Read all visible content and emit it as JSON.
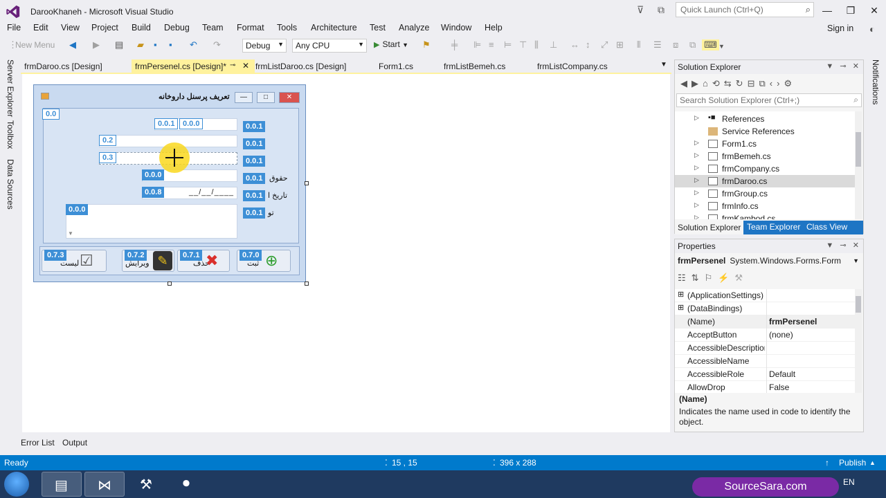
{
  "window": {
    "title": "DarooKhaneh - Microsoft Visual Studio",
    "quick_launch_placeholder": "Quick Launch (Ctrl+Q)"
  },
  "menu": [
    "File",
    "Edit",
    "View",
    "Project",
    "Build",
    "Debug",
    "Team",
    "Format",
    "Tools",
    "Architecture",
    "Test",
    "Analyze",
    "Window",
    "Help"
  ],
  "sign_in": "Sign in",
  "toolbar": {
    "new_menu": "New Menu",
    "config": "Debug",
    "platform": "Any CPU",
    "start": "Start"
  },
  "left_rail": [
    "Server Explorer",
    "Toolbox",
    "Data Sources"
  ],
  "right_rail": "Notifications",
  "doc_tabs": [
    {
      "label": "frmDaroo.cs [Design]"
    },
    {
      "label": "frmPersenel.cs [Design]*"
    },
    {
      "label": "frmListDaroo.cs [Design]"
    },
    {
      "label": "Form1.cs"
    },
    {
      "label": "frmListBemeh.cs"
    },
    {
      "label": "frmListCompany.cs"
    }
  ],
  "designer": {
    "form_title": "تعریف پرسنل داروخانه",
    "labels": {
      "salary": "حقوق",
      "date": "تاریخ ا",
      "desc": "تو",
      "btn_list": "لیست",
      "btn_edit": "ویرایش",
      "btn_delete": "حذف",
      "btn_save": "ثبت"
    },
    "tab_order": {
      "group": "0.0",
      "field_a": "0.0.1",
      "field_b": "0.0.0",
      "field_c": "0.2",
      "field_d": "0.3",
      "field_e": "0.0.0",
      "field_f": "0.0.8",
      "memo": "0.0.0",
      "label_1": "0.0.1",
      "label_2": "0.0.1",
      "label_3": "0.0.1",
      "label_4": "0.0.1",
      "label_5": "0.0.1",
      "label_6": "0.0.1",
      "btn_list": "0.7.3",
      "btn_edit": "0.7.2",
      "btn_delete": "0.7.1",
      "btn_save": "0.7.0"
    },
    "date_mask": "__/__/____"
  },
  "solution_explorer": {
    "title": "Solution Explorer",
    "search_placeholder": "Search Solution Explorer (Ctrl+;)",
    "items": [
      {
        "label": "References",
        "kind": "ref"
      },
      {
        "label": "Service References",
        "kind": "folder"
      },
      {
        "label": "Form1.cs",
        "kind": "form"
      },
      {
        "label": "frmBemeh.cs",
        "kind": "form"
      },
      {
        "label": "frmCompany.cs",
        "kind": "form"
      },
      {
        "label": "frmDaroo.cs",
        "kind": "form"
      },
      {
        "label": "frmGroup.cs",
        "kind": "form"
      },
      {
        "label": "frmInfo.cs",
        "kind": "form"
      },
      {
        "label": "frmKambod.cs",
        "kind": "form"
      }
    ],
    "tabs": [
      "Solution Explorer",
      "Team Explorer",
      "Class View"
    ]
  },
  "properties": {
    "title": "Properties",
    "object_name": "frmPersenel",
    "object_type": "System.Windows.Forms.Form",
    "rows": [
      {
        "name": "(ApplicationSettings)",
        "value": "",
        "expander": "⊞"
      },
      {
        "name": "(DataBindings)",
        "value": "",
        "expander": "⊞"
      },
      {
        "name": "(Name)",
        "value": "frmPersenel",
        "expander": ""
      },
      {
        "name": "AcceptButton",
        "value": "(none)",
        "expander": ""
      },
      {
        "name": "AccessibleDescriptior",
        "value": "",
        "expander": ""
      },
      {
        "name": "AccessibleName",
        "value": "",
        "expander": ""
      },
      {
        "name": "AccessibleRole",
        "value": "Default",
        "expander": ""
      },
      {
        "name": "AllowDrop",
        "value": "False",
        "expander": ""
      }
    ],
    "desc_title": "(Name)",
    "desc_text": "Indicates the name used in code to identify the object."
  },
  "bottom_tabs": [
    "Error List",
    "Output"
  ],
  "status": {
    "left": "Ready",
    "position": "15 , 15",
    "size": "396 x 288",
    "publish": "Publish"
  },
  "taskbar": {
    "lang": "EN",
    "watermark": "SourceSara.com"
  },
  "colors": {
    "accent": "#007acc",
    "active_tab": "#fff29d",
    "tab_order_badge": "#3d8fd6"
  }
}
